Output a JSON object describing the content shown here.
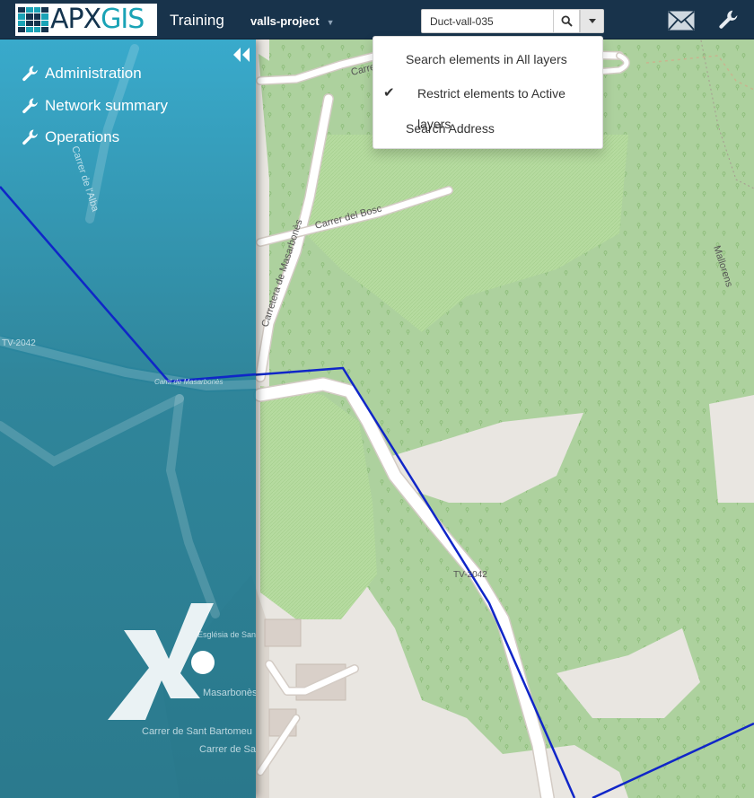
{
  "header": {
    "logo": {
      "apx": "APX",
      "gis": "GIS"
    },
    "app_title": "Training",
    "project": "valls-project",
    "search": {
      "value": "Duct-vall-035"
    },
    "icons": {
      "search": "search-icon",
      "dropdown": "caret-down-icon",
      "mail": "mail-icon",
      "settings": "wrench-icon"
    }
  },
  "search_menu": {
    "items": [
      {
        "label": "Search elements in All layers",
        "checked": false
      },
      {
        "label": "Restrict elements to Active layers",
        "checked": true
      },
      {
        "label": "Search Address",
        "checked": false
      }
    ]
  },
  "sidebar": {
    "items": [
      {
        "label": "Administration",
        "icon": "wrench-icon"
      },
      {
        "label": "Network summary",
        "icon": "wrench-icon"
      },
      {
        "label": "Operations",
        "icon": "wrench-icon"
      }
    ],
    "collapse_icon": "double-chevron-left-icon",
    "brand_icon": "x-brand-icon"
  },
  "map": {
    "labels": {
      "alba": "Carrer de l'Alba",
      "bosc": "Carrer del Bosc",
      "carretera": "Carretera de Masarbonès",
      "tv_left": "TV-2042",
      "tv_mid": "TV-2042",
      "cami": "Camí de Masarbonès",
      "esglesia": "Església de Sant Bartomeu",
      "village": "Masarbonès",
      "bartomeu": "Carrer de Sant Bartomeu",
      "antoni": "Carrer de Sant Antoni",
      "top_road": "Carrer",
      "mallorens": "Mallorens"
    },
    "colors": {
      "forest": "#add19e",
      "land": "#e9e6e1",
      "road": "#ffffff",
      "duct": "#1026c8"
    }
  }
}
